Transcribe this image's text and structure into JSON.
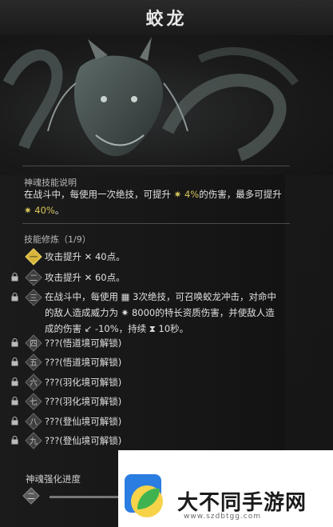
{
  "title": "蛟龙",
  "skill_desc": {
    "heading": "神魂技能说明",
    "line1_pre": "在战斗中，每使用一次绝技，可提升 ",
    "line1_val": "4%",
    "line1_post": "的伤害，最多可提升",
    "line2_val": "40%",
    "line2_post": "。"
  },
  "training": {
    "heading": "技能修炼（1/9）",
    "rows": [
      {
        "numeral": "一",
        "text": "攻击提升 ✕ 40点。",
        "locked": false,
        "active": true
      },
      {
        "numeral": "二",
        "text": "攻击提升 ✕ 60点。",
        "locked": true,
        "active": false
      },
      {
        "numeral": "三",
        "locked": true,
        "active": false,
        "lines": [
          "在战斗中，每使用 ▦ 3次绝技，可召唤蛟龙冲击，对命中",
          "的敌人造成威力为 ✷ 8000的特长资质伤害，并使敌人造",
          "成的伤害 ↙ -10%，持续 ⧗ 10秒。"
        ]
      },
      {
        "numeral": "四",
        "text": "???(悟道境可解锁)",
        "locked": true,
        "active": false
      },
      {
        "numeral": "五",
        "text": "???(悟道境可解锁)",
        "locked": true,
        "active": false
      },
      {
        "numeral": "六",
        "text": "???(羽化境可解锁)",
        "locked": true,
        "active": false
      },
      {
        "numeral": "七",
        "text": "???(羽化境可解锁)",
        "locked": true,
        "active": false
      },
      {
        "numeral": "八",
        "text": "???(登仙境可解锁)",
        "locked": true,
        "active": false
      },
      {
        "numeral": "九",
        "text": "???(登仙境可解锁)",
        "locked": true,
        "active": false
      }
    ]
  },
  "progress": {
    "label": "神魂强化进度",
    "numeral": "二"
  },
  "ad": {
    "text": "大不同手游网",
    "url": "www.szdbtgg.com"
  },
  "colors": {
    "accent": "#d7c55a",
    "bg": "#161616"
  }
}
